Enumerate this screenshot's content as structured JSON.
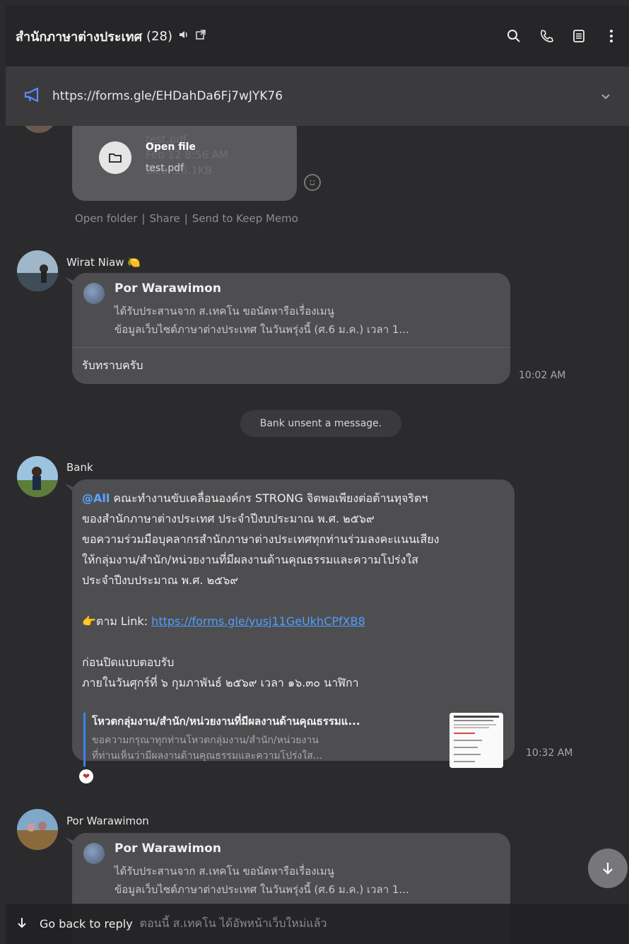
{
  "header": {
    "title": "สำนักภาษาต่างประเทศ",
    "member_count": "(28)",
    "icons": [
      "speaker-icon",
      "popout-icon",
      "search-icon",
      "phone-icon",
      "notes-icon",
      "more-icon"
    ]
  },
  "announcement": {
    "icon": "megaphone-icon",
    "text": "https://forms.gle/EHDahDa6Fj7wJYK76"
  },
  "file_message": {
    "ghost_lines": [
      "test.pdf",
      "Feb 12 8:56 AM",
      "Size: 16.1KB"
    ],
    "open_label": "Open file",
    "file_name": "test.pdf",
    "actions": [
      "Open folder",
      "Share",
      "Send to Keep Memo"
    ],
    "separator": "|"
  },
  "message_wirat": {
    "sender": "Wirat Niaw 🍋",
    "quote_name": "Por Warawimon",
    "quote_line1": "ได้รับประสานจาก ส.เทคโน ขอนัดหารือเรื่องเมนู",
    "quote_line2": "ข้อมูลเว็บไซต์ภาษาต่างประเทศ ในวันพรุ่งนี้ (ศ.6 ม.ค.) เวลา 1...",
    "text": "รับทราบครับ",
    "time": "10:02 AM"
  },
  "system_notice": "Bank unsent a message.",
  "message_bank": {
    "sender": "Bank",
    "mention": "@All",
    "line1": " คณะทำงานขับเคลื่อนองค์กร STRONG จิตพอเพียงต่อต้านทุจริตฯ",
    "line2": "ของสำนักภาษาต่างประเทศ ประจำปีงบประมาณ พ.ศ. ๒๕๖๙",
    "line3": "ขอความร่วมมือบุคลากรสำนักภาษาต่างประเทศทุกท่านร่วมลงคะแนนเสียง",
    "line4": "ให้กลุ่มงาน/สำนัก/หน่วยงานที่มีผลงานด้านคุณธรรมและความโปร่งใส",
    "line5": "ประจำปีงบประมาณ พ.ศ. ๒๕๖๙",
    "link_prefix": "👉ตาม Link: ",
    "link": "https://forms.gle/yusj11GeUkhCPfXB8",
    "line6": "ก่อนปิดแบบตอบรับ",
    "line7": "ภายในวันศุกร์ที่ ๖ กุมภาพันธ์ ๒๕๖๙ เวลา ๑๖.๓๐ นาฬิกา",
    "preview_title": "โหวตกลุ่มงาน/สำนัก/หน่วยงานที่มีผลงานด้านคุณธรรมแ...",
    "preview_desc1": "ขอความกรุณาทุกท่านโหวตกลุ่มงาน/สำนัก/หน่วยงาน",
    "preview_desc2": "ที่ท่านเห็นว่ามีผลงานด้านคุณธรรมและความโปร่งใส...",
    "time": "10:32 AM",
    "reaction": "❤"
  },
  "message_por": {
    "sender": "Por Warawimon",
    "quote_name": "Por Warawimon",
    "quote_line1": "ได้รับประสานจาก ส.เทคโน ขอนัดหารือเรื่องเมนู",
    "quote_line2": "ข้อมูลเว็บไซต์ภาษาต่างประเทศ ในวันพรุ่งนี้ (ศ.6 ม.ค.) เวลา 1..."
  },
  "go_back": {
    "label": "Go back to reply",
    "underlay": "ตอนนี้ ส.เทคโน ได้อัพหน้าเว็บใหม่แล้ว"
  },
  "colors": {
    "background": "#2b2b2d",
    "bubble": "#4e4e51",
    "accent": "#4f9fff",
    "announce_icon": "#5b8cff"
  }
}
